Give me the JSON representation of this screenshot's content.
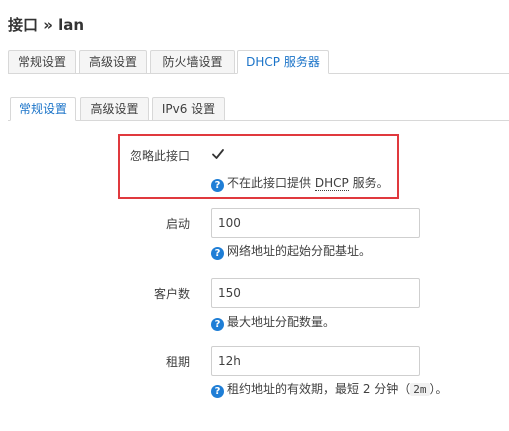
{
  "header": {
    "title": "接口 » lan"
  },
  "main_tabs": [
    {
      "label": "常规设置"
    },
    {
      "label": "高级设置"
    },
    {
      "label": "防火墙设置"
    },
    {
      "label": "DHCP 服务器"
    }
  ],
  "sub_tabs": [
    {
      "label": "常规设置"
    },
    {
      "label": "高级设置"
    },
    {
      "label": "IPv6 设置"
    }
  ],
  "form": {
    "ignore": {
      "label": "忽略此接口",
      "checked": true,
      "help_before": "不在此接口提供",
      "help_abbr": "DHCP",
      "help_after": "服务。"
    },
    "start": {
      "label": "启动",
      "value": "100",
      "help": "网络地址的起始分配基址。"
    },
    "limit": {
      "label": "客户数",
      "value": "150",
      "help": "最大地址分配数量。"
    },
    "lease": {
      "label": "租期",
      "value": "12h",
      "help_before": "租约地址的有效期，最短 2 分钟（",
      "help_code": "2m",
      "help_after": "）。"
    }
  },
  "colors": {
    "accent": "#1a73c8",
    "highlight": "#e0393e",
    "help_icon": "#1f7ed6"
  },
  "icons": {
    "help": "help-icon",
    "check": "check-icon"
  }
}
